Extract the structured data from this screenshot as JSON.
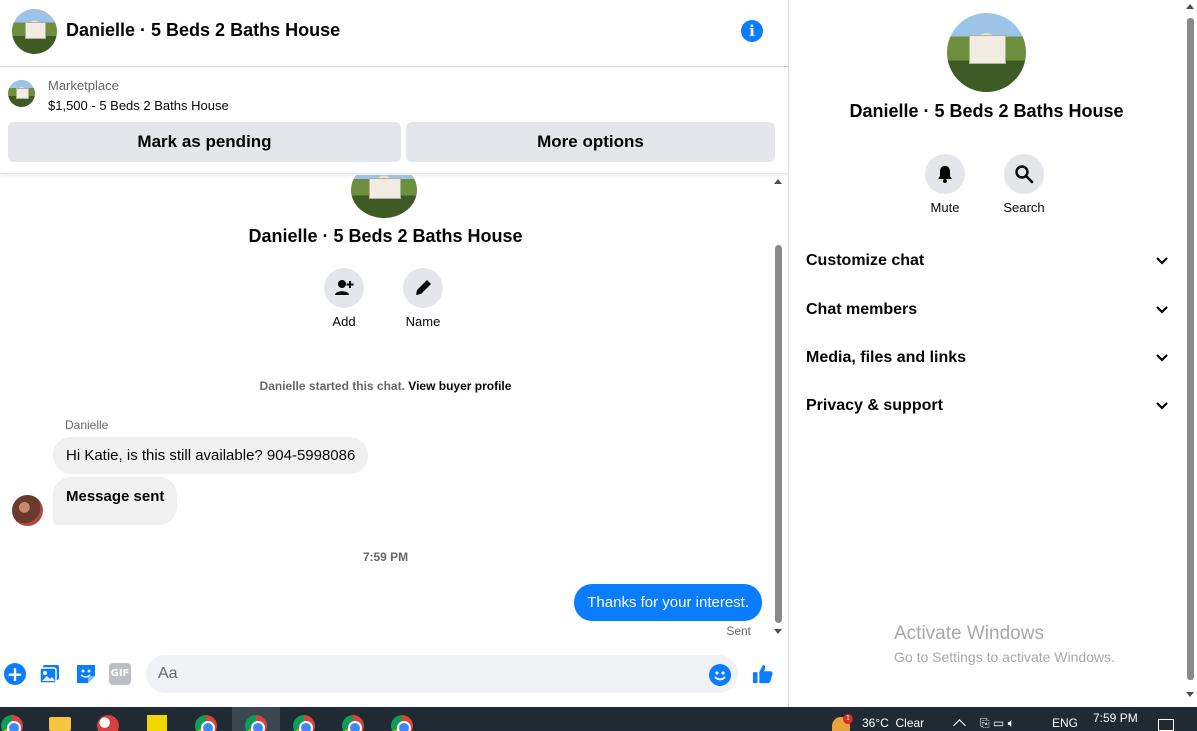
{
  "header": {
    "title": "Danielle · 5 Beds 2 Baths House",
    "info_icon": "info-icon"
  },
  "marketplace": {
    "label": "Marketplace",
    "item": "$1,500 - 5 Beds 2 Baths House",
    "mark_pending_label": "Mark as pending",
    "more_options_label": "More options"
  },
  "thread": {
    "title": "Danielle · 5 Beds 2 Baths House",
    "add_label": "Add",
    "name_label": "Name",
    "started_text": "Danielle started this chat.",
    "view_buyer_profile": "View buyer profile",
    "sender_name": "Danielle",
    "messages_in": [
      "Hi Katie, is this still available? 904-5998086",
      "Message sent"
    ],
    "time_separator": "7:59 PM",
    "message_out": "Thanks for your interest.",
    "sent_status": "Sent"
  },
  "composer": {
    "placeholder": "Aa",
    "gif_label": "GIF",
    "icons": [
      "plus-icon",
      "photo-icon",
      "sticker-icon",
      "gif-icon",
      "emoji-icon",
      "like-icon"
    ]
  },
  "sidebar": {
    "title": "Danielle · 5 Beds 2 Baths House",
    "mute_label": "Mute",
    "search_label": "Search",
    "sections": [
      "Customize chat",
      "Chat members",
      "Media, files and links",
      "Privacy & support"
    ]
  },
  "watermark": {
    "line1": "Activate Windows",
    "line2": "Go to Settings to activate Windows."
  },
  "taskbar": {
    "weather": "36°C  Clear",
    "weather_badge": "1",
    "language": "ENG",
    "time": "7:59 PM"
  },
  "colors": {
    "accent": "#0a7cff",
    "bubble_in": "#f0f0f0",
    "button_bg": "#e4e6eb",
    "taskbar": "#1f2a33"
  }
}
